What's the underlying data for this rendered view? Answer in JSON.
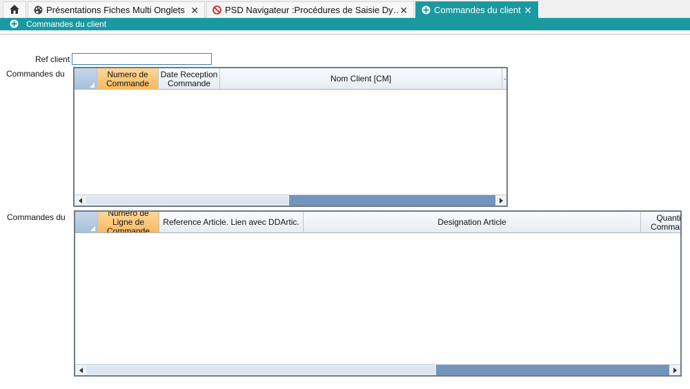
{
  "tabs": [
    {
      "label": "",
      "icon": "home-icon"
    },
    {
      "label": "Présentations Fiches Multi Onglets",
      "icon": "palette-icon",
      "close": "✕"
    },
    {
      "label": "PSD Navigateur :Procédures de Saisie Dy…",
      "icon": "no-entry-icon",
      "close": "✕"
    },
    {
      "label": "Commandes du client",
      "icon": "window-icon",
      "close": "✕",
      "active": true
    }
  ],
  "window": {
    "title": "Commandes du client",
    "icon": "window-icon",
    "accent": "#1a9aa0"
  },
  "form": {
    "ref_label": "Ref client",
    "ref_value": "",
    "grid1_label": "Commandes du cli",
    "grid2_label": "Commandes du cli"
  },
  "grid1": {
    "columns": [
      "Numero de Commande",
      "Date Reception Commande",
      "Nom Client [CM]",
      "·"
    ],
    "rows": []
  },
  "grid2": {
    "columns": [
      "Numero de Ligne de Commande",
      "Reference Article. Lien avec DDArtic.",
      "Designation Article",
      "Quantité Commandé"
    ],
    "rows": []
  }
}
